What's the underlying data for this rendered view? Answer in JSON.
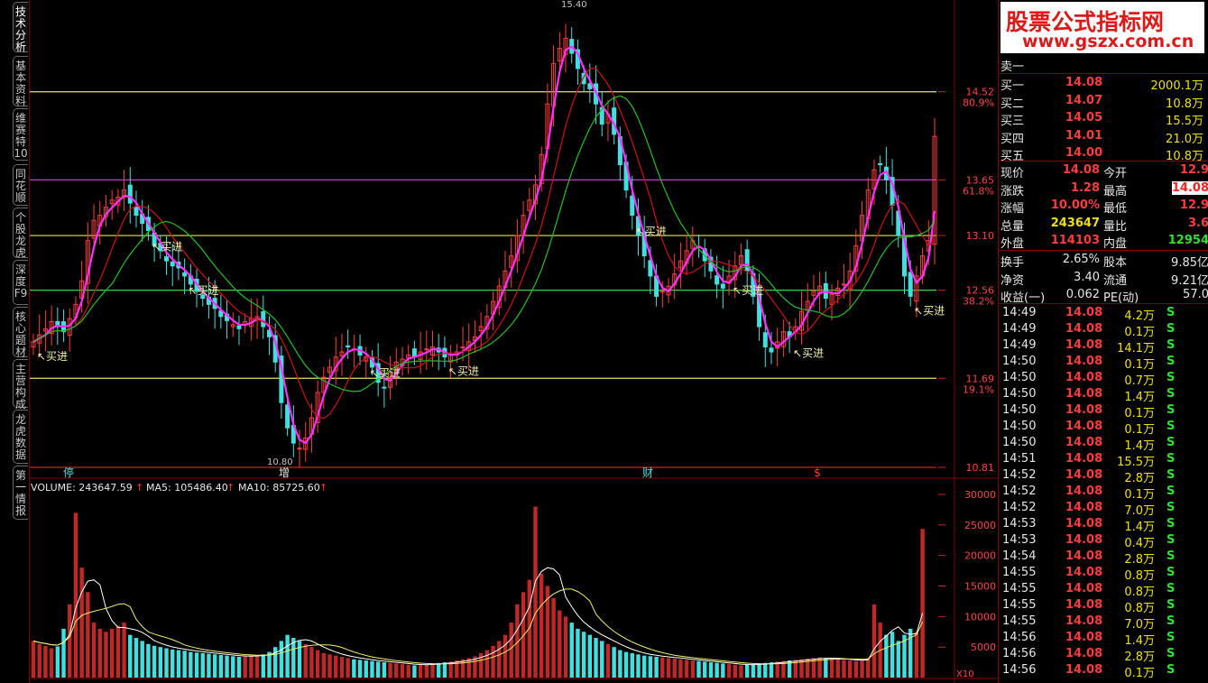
{
  "sidebar": {
    "tabs": [
      {
        "label": "技术分析",
        "active": true
      },
      {
        "label": "基本资料",
        "active": false
      },
      {
        "label": "维赛特10",
        "active": false
      },
      {
        "label": "同花顺",
        "active": false
      },
      {
        "label": "个股龙虎",
        "active": false
      },
      {
        "label": "深度F9",
        "active": false
      },
      {
        "label": "核心题材",
        "active": false
      },
      {
        "label": "主营构成",
        "active": false
      },
      {
        "label": "龙虎数据",
        "active": false
      },
      {
        "label": "第一情报",
        "active": false
      }
    ]
  },
  "price_panel": {
    "fib_labels": [
      {
        "price": "14.52",
        "pct": "80.9%"
      },
      {
        "price": "13.65",
        "pct": "61.8%"
      },
      {
        "price": "13.10",
        "pct": ""
      },
      {
        "price": "12.56",
        "pct": "38.2%"
      },
      {
        "price": "11.69",
        "pct": "19.1%"
      },
      {
        "price": "10.81",
        "pct": ""
      }
    ],
    "high_label": "15.40",
    "low_label": "10.80",
    "buy_label": "买进",
    "event_markers": [
      {
        "label": "停",
        "color": "#40e0e0"
      },
      {
        "label": "增",
        "color": "#e6e6e6"
      },
      {
        "label": "财",
        "color": "#40e0e0"
      },
      {
        "label": "$",
        "color": "#ff3c3c"
      }
    ]
  },
  "volume_panel": {
    "volume_label": "VOLUME: 243647.59",
    "ma5_label": "MA5: 105486.40",
    "ma10_label": "MA10: 85725.60",
    "axis_ticks": [
      "30000",
      "25000",
      "20000",
      "15000",
      "10000",
      "5000"
    ],
    "unit": "X10"
  },
  "quote": {
    "logo_line1": "股票公式指标网",
    "logo_line2": "www.gszx.com.cn",
    "sell1": {
      "label": "卖一",
      "price": "",
      "vol": ""
    },
    "bids": [
      {
        "label": "买一",
        "price": "14.08",
        "vol": "2000.1万"
      },
      {
        "label": "买二",
        "price": "14.07",
        "vol": "10.8万"
      },
      {
        "label": "买三",
        "price": "14.05",
        "vol": "15.5万"
      },
      {
        "label": "买四",
        "price": "14.01",
        "vol": "21.0万"
      },
      {
        "label": "买五",
        "price": "14.00",
        "vol": "10.8万"
      }
    ],
    "stats": [
      {
        "l1": "现价",
        "v1": "14.08",
        "l2": "今开",
        "v2": "12.9"
      },
      {
        "l1": "涨跌",
        "v1": "1.28",
        "l2": "最高",
        "v2": "14.08"
      },
      {
        "l1": "涨幅",
        "v1": "10.00%",
        "l2": "最低",
        "v2": "12.9"
      },
      {
        "l1": "总量",
        "v1": "243647",
        "l2": "量比",
        "v2": "3.6"
      },
      {
        "l1": "外盘",
        "v1": "114103",
        "l2": "内盘",
        "v2": "12954"
      }
    ],
    "fund": [
      {
        "l1": "换手",
        "v1": "2.65%",
        "l2": "股本",
        "v2": "9.85亿"
      },
      {
        "l1": "净资",
        "v1": "3.40",
        "l2": "流通",
        "v2": "9.21亿"
      },
      {
        "l1": "收益(一)",
        "v1": "0.062",
        "l2": "PE(动)",
        "v2": "57.0"
      }
    ],
    "ticks": [
      {
        "t": "14:49",
        "p": "14.08",
        "v": "4.2万",
        "s": "S"
      },
      {
        "t": "14:49",
        "p": "14.08",
        "v": "0.1万",
        "s": "S"
      },
      {
        "t": "14:49",
        "p": "14.08",
        "v": "14.1万",
        "s": "S"
      },
      {
        "t": "14:50",
        "p": "14.08",
        "v": "0.1万",
        "s": "S"
      },
      {
        "t": "14:50",
        "p": "14.08",
        "v": "0.7万",
        "s": "S"
      },
      {
        "t": "14:50",
        "p": "14.08",
        "v": "1.4万",
        "s": "S"
      },
      {
        "t": "14:50",
        "p": "14.08",
        "v": "0.1万",
        "s": "S"
      },
      {
        "t": "14:50",
        "p": "14.08",
        "v": "0.1万",
        "s": "S"
      },
      {
        "t": "14:50",
        "p": "14.08",
        "v": "1.4万",
        "s": "S"
      },
      {
        "t": "14:51",
        "p": "14.08",
        "v": "15.5万",
        "s": "S"
      },
      {
        "t": "14:52",
        "p": "14.08",
        "v": "2.8万",
        "s": "S"
      },
      {
        "t": "14:52",
        "p": "14.08",
        "v": "0.1万",
        "s": "S"
      },
      {
        "t": "14:52",
        "p": "14.08",
        "v": "7.0万",
        "s": "S"
      },
      {
        "t": "14:53",
        "p": "14.08",
        "v": "1.4万",
        "s": "S"
      },
      {
        "t": "14:53",
        "p": "14.08",
        "v": "0.4万",
        "s": "S"
      },
      {
        "t": "14:54",
        "p": "14.08",
        "v": "2.8万",
        "s": "S"
      },
      {
        "t": "14:55",
        "p": "14.08",
        "v": "0.8万",
        "s": "S"
      },
      {
        "t": "14:55",
        "p": "14.08",
        "v": "0.8万",
        "s": "S"
      },
      {
        "t": "14:55",
        "p": "14.08",
        "v": "0.8万",
        "s": "S"
      },
      {
        "t": "14:55",
        "p": "14.08",
        "v": "7.0万",
        "s": "S"
      },
      {
        "t": "14:56",
        "p": "14.08",
        "v": "1.4万",
        "s": "S"
      },
      {
        "t": "14:56",
        "p": "14.08",
        "v": "2.8万",
        "s": "S"
      },
      {
        "t": "14:56",
        "p": "14.08",
        "v": "0.1万",
        "s": "S"
      }
    ]
  },
  "colors": {
    "up": "#ff3c3c",
    "down": "#40e0e0",
    "ma_pink": "#ff30ff",
    "ma_red": "#d01010",
    "ma_green": "#20c020",
    "fib_yellow": "#e8e060",
    "fib_purple": "#c040c0",
    "fib_green": "#40d040",
    "fib_red": "#d02020"
  },
  "chart_data": {
    "type": "candlestick",
    "price_axis": {
      "min": 10.81,
      "max": 15.4
    },
    "fib_levels": [
      14.52,
      13.65,
      13.1,
      12.56,
      11.69,
      10.81
    ],
    "close": [
      12.05,
      12.12,
      12.18,
      12.25,
      12.2,
      12.15,
      12.28,
      12.42,
      12.65,
      13.05,
      13.25,
      13.3,
      13.38,
      13.45,
      13.48,
      13.55,
      13.42,
      13.3,
      13.22,
      13.15,
      13.0,
      12.95,
      12.85,
      12.8,
      12.78,
      12.7,
      12.62,
      12.55,
      12.48,
      12.42,
      12.38,
      12.3,
      12.26,
      12.22,
      12.18,
      12.25,
      12.28,
      12.3,
      12.2,
      12.1,
      11.85,
      11.45,
      11.2,
      11.05,
      11.0,
      11.1,
      11.3,
      11.55,
      11.7,
      11.8,
      11.9,
      11.95,
      12.0,
      11.98,
      11.92,
      11.9,
      11.8,
      11.65,
      11.6,
      11.75,
      11.85,
      11.88,
      11.92,
      11.9,
      11.95,
      11.98,
      12.0,
      11.95,
      11.9,
      11.92,
      11.95,
      12.0,
      12.05,
      12.1,
      12.2,
      12.3,
      12.45,
      12.6,
      12.75,
      12.9,
      13.1,
      13.3,
      13.45,
      13.6,
      13.9,
      14.4,
      14.8,
      14.95,
      15.05,
      14.9,
      14.75,
      14.6,
      14.55,
      14.4,
      14.2,
      14.3,
      14.1,
      13.8,
      13.55,
      13.3,
      13.1,
      12.9,
      12.7,
      12.5,
      12.55,
      12.6,
      12.72,
      12.85,
      12.95,
      13.05,
      12.98,
      12.85,
      12.75,
      12.62,
      12.58,
      12.7,
      12.8,
      12.9,
      12.75,
      12.5,
      12.2,
      12.0,
      11.95,
      12.05,
      12.15,
      12.1,
      12.2,
      12.35,
      12.45,
      12.55,
      12.6,
      12.48,
      12.52,
      12.58,
      12.62,
      12.75,
      13.0,
      13.3,
      13.55,
      13.75,
      13.8,
      13.65,
      13.4,
      13.1,
      12.7,
      12.5,
      12.7,
      12.9,
      13.05,
      14.08
    ],
    "volume": [
      6000,
      5500,
      5200,
      4800,
      5100,
      8000,
      12000,
      27000,
      18000,
      14000,
      9000,
      8000,
      7500,
      8000,
      8500,
      9000,
      7000,
      6500,
      6000,
      5500,
      5200,
      5000,
      4800,
      4600,
      4500,
      4400,
      4200,
      4100,
      4000,
      3900,
      3800,
      3700,
      3600,
      3500,
      3400,
      3500,
      3600,
      3700,
      3800,
      4200,
      5000,
      6000,
      7000,
      6500,
      6000,
      5500,
      5000,
      4500,
      4000,
      3800,
      3600,
      3400,
      3200,
      3000,
      2900,
      2800,
      2700,
      2600,
      2500,
      2400,
      2300,
      2200,
      2100,
      2000,
      2100,
      2200,
      2300,
      2400,
      2500,
      2600,
      2800,
      3000,
      3200,
      3500,
      4000,
      4500,
      5200,
      6000,
      7000,
      9000,
      12000,
      14000,
      16000,
      28000,
      17000,
      15000,
      13000,
      11000,
      10000,
      9000,
      8000,
      7500,
      7000,
      6500,
      6000,
      5500,
      5000,
      4500,
      4200,
      4000,
      3800,
      3600,
      3500,
      3400,
      3300,
      3200,
      3100,
      3000,
      2900,
      2800,
      2700,
      2600,
      2500,
      2400,
      2300,
      2200,
      2100,
      2000,
      2100,
      2200,
      2300,
      2400,
      2500,
      2600,
      2700,
      2800,
      2900,
      3000,
      3100,
      3200,
      3300,
      3200,
      3100,
      3000,
      2900,
      2800,
      2700,
      2900,
      3200,
      12000,
      9000,
      7000,
      7500,
      6000,
      7000,
      8000,
      7500,
      24364
    ]
  }
}
